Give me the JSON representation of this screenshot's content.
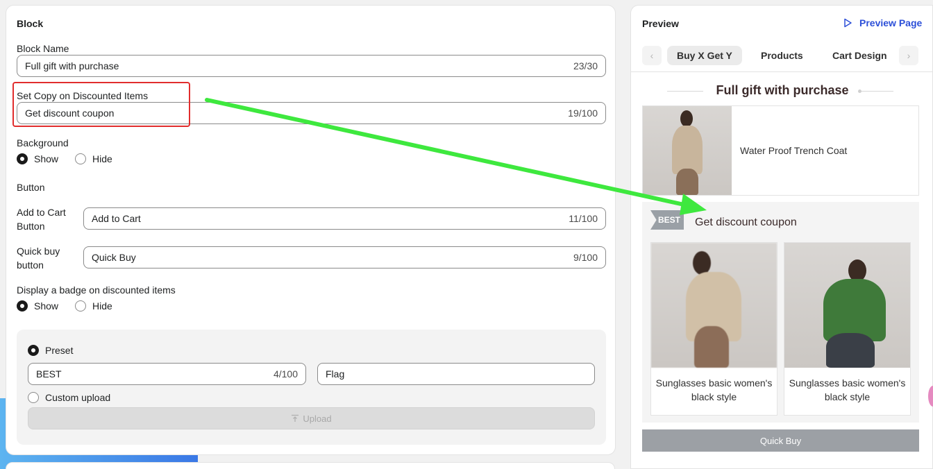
{
  "block": {
    "title": "Block",
    "block_name_label": "Block Name",
    "block_name_value": "Full gift with purchase",
    "block_name_count": "23/30",
    "copy_label": "Set Copy on Discounted Items",
    "copy_value": "Get discount coupon",
    "copy_count": "19/100",
    "background_label": "Background",
    "background_options": [
      "Show",
      "Hide"
    ],
    "background_selected": "Show",
    "button_section_label": "Button",
    "add_to_cart_label": "Add to Cart Button",
    "add_to_cart_value": "Add to Cart",
    "add_to_cart_count": "11/100",
    "quick_buy_label": "Quick buy button",
    "quick_buy_value": "Quick Buy",
    "quick_buy_count": "9/100",
    "badge_label": "Display a badge on discounted items",
    "badge_options": [
      "Show",
      "Hide"
    ],
    "badge_selected": "Show",
    "preset_label": "Preset",
    "badge_text_value": "BEST",
    "badge_text_count": "4/100",
    "badge_style_value": "Flag",
    "custom_upload_label": "Custom upload",
    "upload_button_label": "Upload"
  },
  "preview": {
    "title": "Preview",
    "preview_page_label": "Preview Page",
    "tabs": [
      "Buy X Get Y",
      "Products",
      "Cart Design"
    ],
    "active_tab": "Buy X Get Y",
    "heading": "Full gift with purchase",
    "main_product": "Water Proof Trench Coat",
    "badge": "BEST",
    "discount_title": "Get discount coupon",
    "items": [
      {
        "name": "Sunglasses basic women's black style"
      },
      {
        "name": "Sunglasses basic women's black style"
      }
    ],
    "quick_buy_label": "Quick Buy"
  },
  "colors": {
    "annotation_box": "#e12d2d",
    "annotation_arrow": "#3ee83e",
    "link_blue": "#2c4fd8"
  },
  "icons": [
    "play-outline-icon",
    "chevron-left-icon",
    "chevron-right-icon",
    "upload-icon"
  ]
}
